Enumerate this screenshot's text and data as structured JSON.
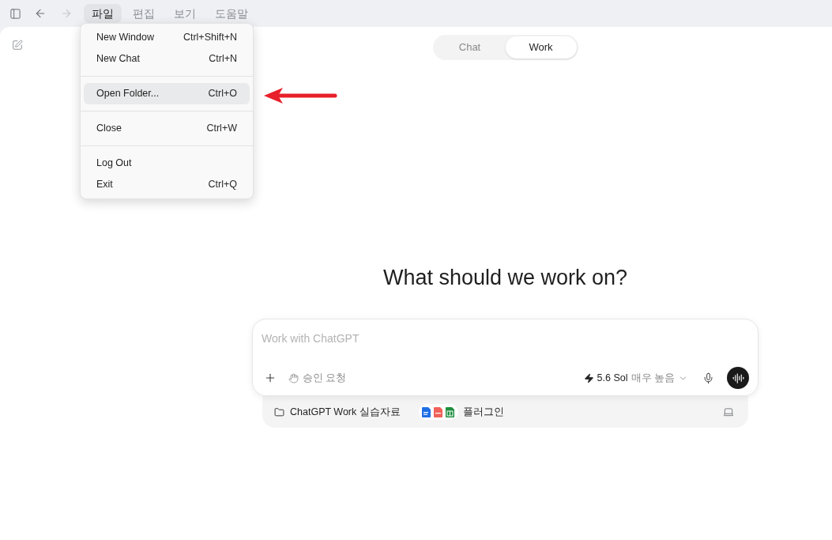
{
  "title_bar": {
    "nav_buttons": [
      {
        "kind": "back",
        "disabled": false
      },
      {
        "kind": "forward",
        "disabled": true
      }
    ],
    "menus": [
      {
        "label": "파일",
        "selected": true
      },
      {
        "label": "편집",
        "selected": false
      },
      {
        "label": "보기",
        "selected": false
      },
      {
        "label": "도움말",
        "selected": false
      }
    ]
  },
  "file_menu": {
    "groups": [
      {
        "items": [
          {
            "label": "New Window",
            "shortcut": "Ctrl+Shift+N",
            "highlighted": false
          },
          {
            "label": "New Chat",
            "shortcut": "Ctrl+N",
            "highlighted": false
          }
        ]
      },
      {
        "items": [
          {
            "label": "Open Folder...",
            "shortcut": "Ctrl+O",
            "highlighted": true
          }
        ]
      },
      {
        "items": [
          {
            "label": "Close",
            "shortcut": "Ctrl+W",
            "highlighted": false
          }
        ]
      },
      {
        "items": [
          {
            "label": "Log Out",
            "highlighted": false
          },
          {
            "label": "Exit",
            "shortcut": "Ctrl+Q",
            "highlighted": false
          }
        ]
      }
    ]
  },
  "mode_tabs": [
    {
      "label": "Chat",
      "selected": false
    },
    {
      "label": "Work",
      "selected": true
    }
  ],
  "heading": "What should we work on?",
  "composer": {
    "placeholder": "Work with ChatGPT",
    "approval_button": "승인 요청",
    "model": {
      "name": "5.6 Sol",
      "effort": "매우 높음"
    }
  },
  "workspace_bar": {
    "folder": "ChatGPT Work 실습자료",
    "plugins": "플러그인"
  }
}
